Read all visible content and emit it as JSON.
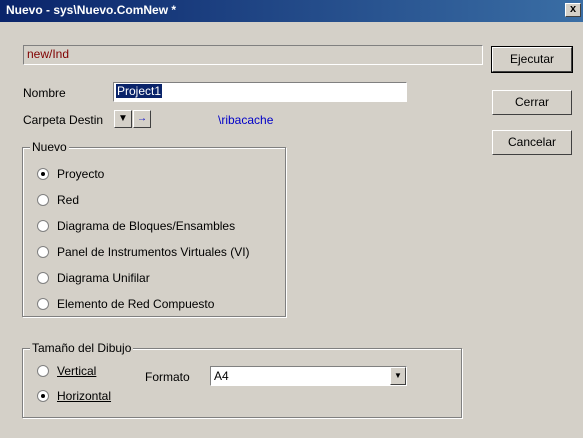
{
  "window": {
    "title": "Nuevo - sys\\Nuevo.ComNew *",
    "close_label": "x"
  },
  "path_value": "new/Ind",
  "nombre": {
    "label": "Nombre",
    "value": "Project1"
  },
  "carpeta": {
    "label": "Carpeta Destin",
    "link": "\\ribacache",
    "dropdown_glyph": "▼",
    "go_glyph": "→"
  },
  "nuevo": {
    "legend": "Nuevo",
    "selected": 0,
    "options": [
      "Proyecto",
      "Red",
      "Diagrama de Bloques/Ensambles",
      "Panel de Instrumentos Virtuales (VI)",
      "Diagrama Unifilar",
      "Elemento de Red Compuesto"
    ]
  },
  "tamano": {
    "legend": "Tamaño del Dibujo",
    "vertical": "Vertical",
    "horizontal": "Horizontal",
    "selected": "Horizontal",
    "formato_label": "Formato",
    "formato_value": "A4",
    "arrow_glyph": "▼"
  },
  "buttons": {
    "ejecutar": "Ejecutar",
    "cerrar": "Cerrar",
    "cancelar": "Cancelar"
  }
}
